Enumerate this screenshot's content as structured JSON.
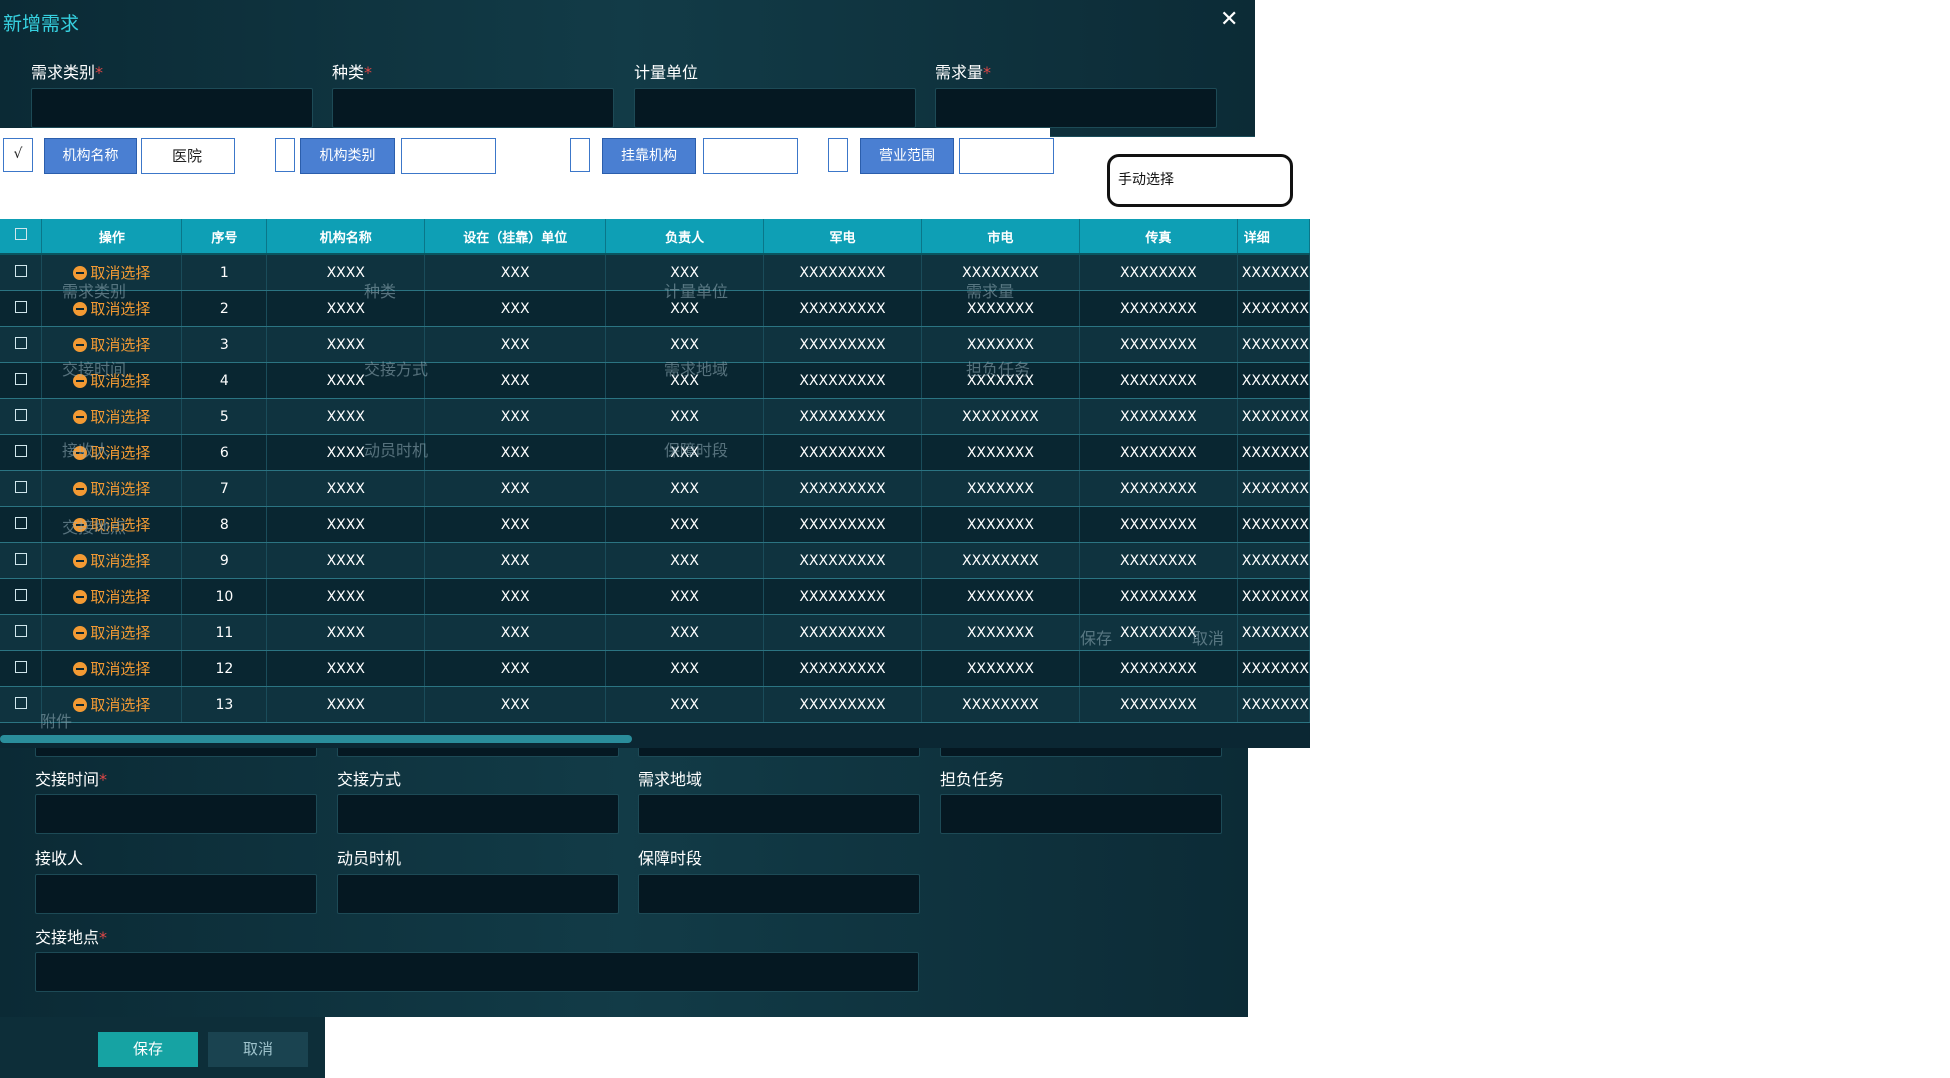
{
  "dialog": {
    "title": "新增需求",
    "close": "✕"
  },
  "top_fields": [
    {
      "label": "需求类别",
      "required": true
    },
    {
      "label": "种类",
      "required": true
    },
    {
      "label": "计量单位",
      "required": false
    },
    {
      "label": "需求量",
      "required": true
    }
  ],
  "filters": {
    "check1": "√",
    "btn1": "机构名称",
    "val1": "医院",
    "btn2": "机构类别",
    "btn3": "挂靠机构",
    "btn4": "营业范围",
    "manual": "手动选择"
  },
  "table": {
    "headers": [
      "操作",
      "序号",
      "机构名称",
      "设在（挂靠）单位",
      "负责人",
      "军电",
      "市电",
      "传真",
      "详细"
    ],
    "action_label": "取消选择",
    "rows": [
      {
        "n": "1",
        "name": "XXXX",
        "unit": "XXX",
        "leader": "XXX",
        "mil": "XXXXXXXXX",
        "city": "XXXXXXXX",
        "fax": "XXXXXXXX",
        "detail": "XXXXXXX"
      },
      {
        "n": "2",
        "name": "XXXX",
        "unit": "XXX",
        "leader": "XXX",
        "mil": "XXXXXXXXX",
        "city": "XXXXXXX",
        "fax": "XXXXXXXX",
        "detail": "XXXXXXX"
      },
      {
        "n": "3",
        "name": "XXXX",
        "unit": "XXX",
        "leader": "XXX",
        "mil": "XXXXXXXXX",
        "city": "XXXXXXX",
        "fax": "XXXXXXXX",
        "detail": "XXXXXXX"
      },
      {
        "n": "4",
        "name": "XXXX",
        "unit": "XXX",
        "leader": "XXX",
        "mil": "XXXXXXXXX",
        "city": "XXXXXXX",
        "fax": "XXXXXXXX",
        "detail": "XXXXXXX"
      },
      {
        "n": "5",
        "name": "XXXX",
        "unit": "XXX",
        "leader": "XXX",
        "mil": "XXXXXXXXX",
        "city": "XXXXXXXX",
        "fax": "XXXXXXXX",
        "detail": "XXXXXXX"
      },
      {
        "n": "6",
        "name": "XXXX",
        "unit": "XXX",
        "leader": "XXX",
        "mil": "XXXXXXXXX",
        "city": "XXXXXXX",
        "fax": "XXXXXXXX",
        "detail": "XXXXXXX"
      },
      {
        "n": "7",
        "name": "XXXX",
        "unit": "XXX",
        "leader": "XXX",
        "mil": "XXXXXXXXX",
        "city": "XXXXXXX",
        "fax": "XXXXXXXX",
        "detail": "XXXXXXX"
      },
      {
        "n": "8",
        "name": "XXXX",
        "unit": "XXX",
        "leader": "XXX",
        "mil": "XXXXXXXXX",
        "city": "XXXXXXX",
        "fax": "XXXXXXXX",
        "detail": "XXXXXXX"
      },
      {
        "n": "9",
        "name": "XXXX",
        "unit": "XXX",
        "leader": "XXX",
        "mil": "XXXXXXXXX",
        "city": "XXXXXXXX",
        "fax": "XXXXXXXX",
        "detail": "XXXXXXX"
      },
      {
        "n": "10",
        "name": "XXXX",
        "unit": "XXX",
        "leader": "XXX",
        "mil": "XXXXXXXXX",
        "city": "XXXXXXX",
        "fax": "XXXXXXXX",
        "detail": "XXXXXXX"
      },
      {
        "n": "11",
        "name": "XXXX",
        "unit": "XXX",
        "leader": "XXX",
        "mil": "XXXXXXXXX",
        "city": "XXXXXXX",
        "fax": "XXXXXXXX",
        "detail": "XXXXXXX"
      },
      {
        "n": "12",
        "name": "XXXX",
        "unit": "XXX",
        "leader": "XXX",
        "mil": "XXXXXXXXX",
        "city": "XXXXXXX",
        "fax": "XXXXXXXX",
        "detail": "XXXXXXX"
      },
      {
        "n": "13",
        "name": "XXXX",
        "unit": "XXX",
        "leader": "XXX",
        "mil": "XXXXXXXXX",
        "city": "XXXXXXXX",
        "fax": "XXXXXXXX",
        "detail": "XXXXXXX"
      }
    ]
  },
  "ghost_labels": {
    "a": "需求类别",
    "b": "种类",
    "c": "计量单位",
    "d": "需求量",
    "e": "交接时间",
    "f": "交接方式",
    "g": "需求地域",
    "h": "担负任务",
    "i": "接收人",
    "j": "动员时机",
    "k": "保障时段",
    "l": "交接地点",
    "m": "附件",
    "n": "保存",
    "o": "取消"
  },
  "bottom_fields": {
    "handover_time": "交接时间",
    "handover_method": "交接方式",
    "demand_region": "需求地域",
    "task": "担负任务",
    "receiver": "接收人",
    "mobilize_time": "动员时机",
    "support_period": "保障时段",
    "handover_place": "交接地点"
  },
  "buttons": {
    "save": "保存",
    "cancel": "取消"
  }
}
